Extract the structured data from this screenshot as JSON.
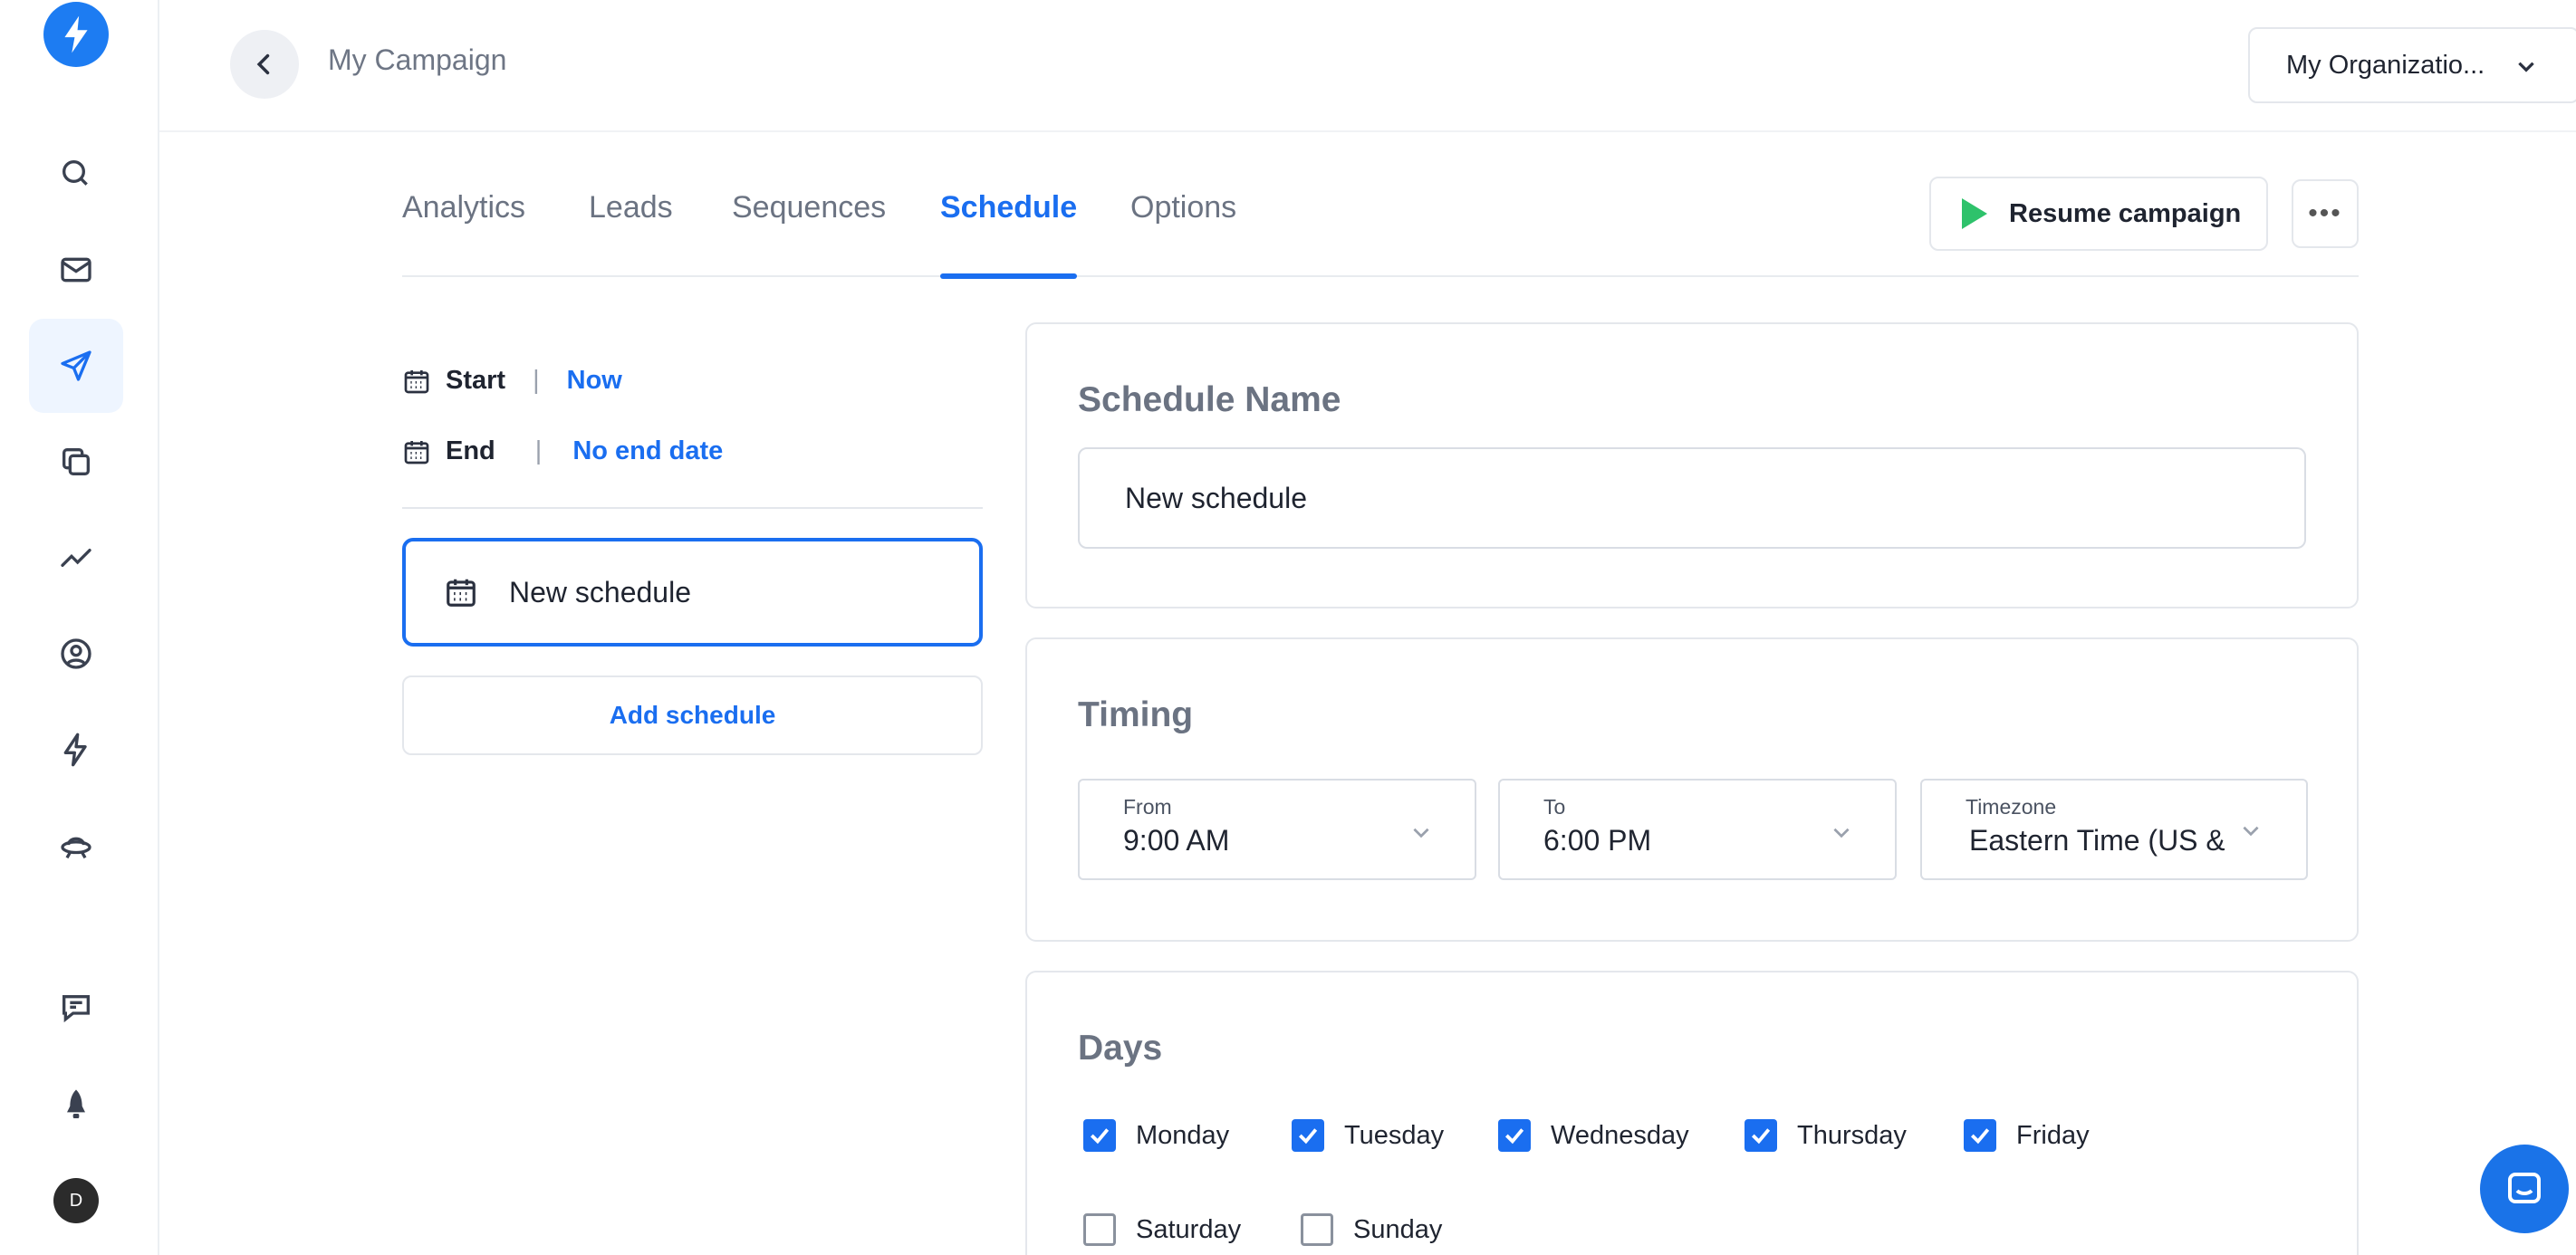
{
  "header": {
    "campaign_title": "My Campaign",
    "organization": "My Organizatio..."
  },
  "tabs": [
    {
      "label": "Analytics",
      "active": false
    },
    {
      "label": "Leads",
      "active": false
    },
    {
      "label": "Sequences",
      "active": false
    },
    {
      "label": "Schedule",
      "active": true
    },
    {
      "label": "Options",
      "active": false
    }
  ],
  "actions": {
    "resume_label": "Resume campaign",
    "more_label": "•••"
  },
  "dates": {
    "start_label": "Start",
    "start_sep": "|",
    "start_value": "Now",
    "end_label": "End",
    "end_sep": "|",
    "end_value": "No end date"
  },
  "schedules": {
    "items": [
      "New schedule"
    ],
    "add_label": "Add schedule"
  },
  "schedule_name": {
    "heading": "Schedule Name",
    "value": "New schedule"
  },
  "timing": {
    "heading": "Timing",
    "from_label": "From",
    "from_value": "9:00 AM",
    "to_label": "To",
    "to_value": "6:00 PM",
    "timezone_label": "Timezone",
    "timezone_value": "Eastern Time (US &"
  },
  "days": {
    "heading": "Days",
    "items": [
      {
        "label": "Monday",
        "checked": true
      },
      {
        "label": "Tuesday",
        "checked": true
      },
      {
        "label": "Wednesday",
        "checked": true
      },
      {
        "label": "Thursday",
        "checked": true
      },
      {
        "label": "Friday",
        "checked": true
      },
      {
        "label": "Saturday",
        "checked": false
      },
      {
        "label": "Sunday",
        "checked": false
      }
    ]
  },
  "user": {
    "avatar_initial": "D"
  },
  "colors": {
    "accent": "#1a6ef0",
    "play": "#2ec26b",
    "logo": "#1d7cf2"
  }
}
